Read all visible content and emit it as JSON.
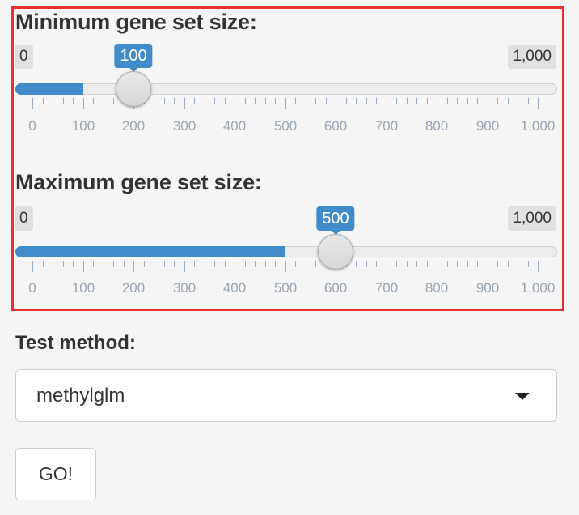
{
  "min_slider": {
    "label": "Minimum gene set size:",
    "min_text": "0",
    "max_text": "1,000",
    "min": 0,
    "max": 1000,
    "value": 100,
    "value_text": "100"
  },
  "max_slider": {
    "label": "Maximum gene set size:",
    "min_text": "0",
    "max_text": "1,000",
    "min": 0,
    "max": 1000,
    "value": 500,
    "value_text": "500"
  },
  "tick_labels": [
    "0",
    "100",
    "200",
    "300",
    "400",
    "500",
    "600",
    "700",
    "800",
    "900",
    "1,000"
  ],
  "test_method": {
    "label": "Test method:",
    "selected": "methylglm"
  },
  "go_button": {
    "label": "GO!"
  },
  "colors": {
    "accent": "#428bca",
    "highlight_border": "#e8312f",
    "background": "#f5f5f5"
  },
  "icons": {
    "dropdown": "caret-down-icon"
  }
}
